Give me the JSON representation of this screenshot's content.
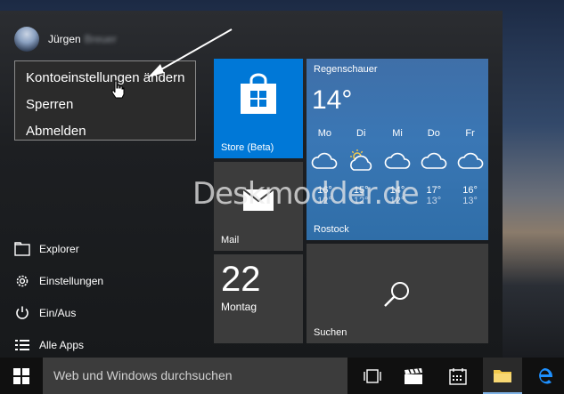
{
  "user": {
    "first_name": "Jürgen",
    "last_name": "Breuer"
  },
  "context_menu": {
    "items": [
      "Kontoeinstellungen ändern",
      "Sperren",
      "Abmelden"
    ]
  },
  "left_list": {
    "explorer": "Explorer",
    "settings": "Einstellungen",
    "power": "Ein/Aus",
    "all_apps": "Alle Apps"
  },
  "tiles": {
    "store": {
      "label": "Store (Beta)"
    },
    "mail": {
      "label": "Mail"
    },
    "calendar": {
      "day_number": "22",
      "weekday": "Montag"
    },
    "search": {
      "label": "Suchen"
    },
    "weather": {
      "condition": "Regenschauer",
      "temperature": "14°",
      "city": "Rostock",
      "forecast": [
        {
          "day": "Mo",
          "high": "16°",
          "low": "12°",
          "icon": "cloud-icon"
        },
        {
          "day": "Di",
          "high": "15°",
          "low": "12°",
          "icon": "sun-cloud-icon"
        },
        {
          "day": "Mi",
          "high": "14°",
          "low": "12°",
          "icon": "cloud-icon"
        },
        {
          "day": "Do",
          "high": "17°",
          "low": "13°",
          "icon": "cloud-icon"
        },
        {
          "day": "Fr",
          "high": "16°",
          "low": "13°",
          "icon": "cloud-icon"
        }
      ]
    }
  },
  "watermark": "Deskmodder.de",
  "taskbar": {
    "search_placeholder": "Web und Windows durchsuchen"
  },
  "colors": {
    "accent": "#0078d7",
    "tile_dark": "#3c3c3c",
    "weather_tile": "#3a77b5"
  }
}
